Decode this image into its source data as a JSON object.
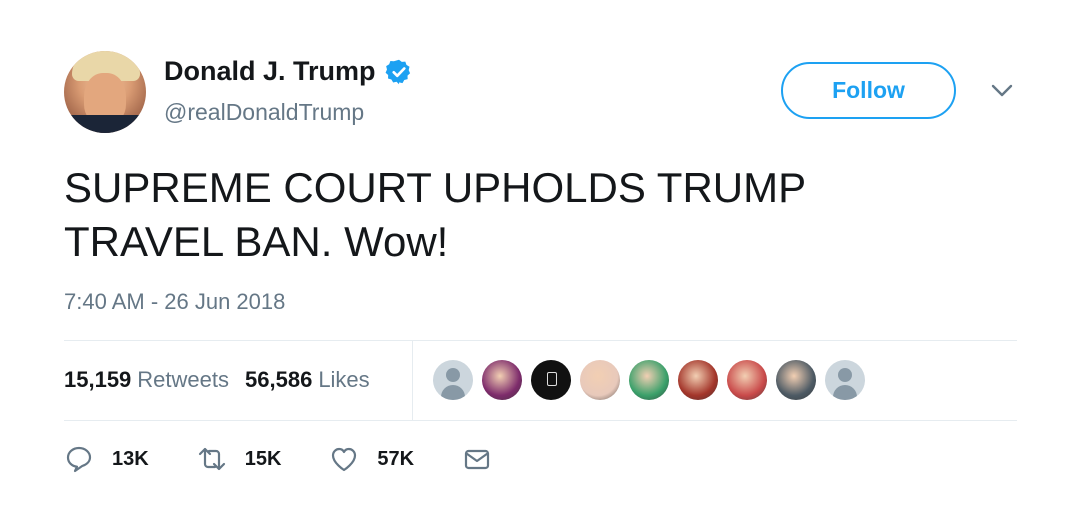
{
  "user": {
    "name": "Donald J. Trump",
    "handle": "@realDonaldTrump",
    "verified_icon": "verified-badge-icon",
    "accent_color": "#1da1f2"
  },
  "header": {
    "follow_label": "Follow",
    "menu_icon": "chevron-down-icon"
  },
  "tweet": {
    "text": "SUPREME COURT UPHOLDS TRUMP TRAVEL BAN. Wow!",
    "timestamp": "7:40 AM - 26 Jun 2018"
  },
  "stats": {
    "retweets_count": "15,159",
    "retweets_label": "Retweets",
    "likes_count": "56,586",
    "likes_label": "Likes"
  },
  "likers": [
    {
      "kind": "default"
    },
    {
      "kind": "photo",
      "color": "#7d2b6b"
    },
    {
      "kind": "logo",
      "color": "#111111"
    },
    {
      "kind": "photo",
      "color": "#e8c9bb"
    },
    {
      "kind": "photo",
      "color": "#3aa06a"
    },
    {
      "kind": "photo",
      "color": "#a3352a"
    },
    {
      "kind": "photo",
      "color": "#c94a4a"
    },
    {
      "kind": "photo",
      "color": "#4d5a64"
    },
    {
      "kind": "default"
    }
  ],
  "actions": {
    "reply_count": "13K",
    "retweet_count": "15K",
    "like_count": "57K",
    "reply_icon": "reply-icon",
    "retweet_icon": "retweet-icon",
    "like_icon": "heart-icon",
    "dm_icon": "envelope-icon"
  }
}
